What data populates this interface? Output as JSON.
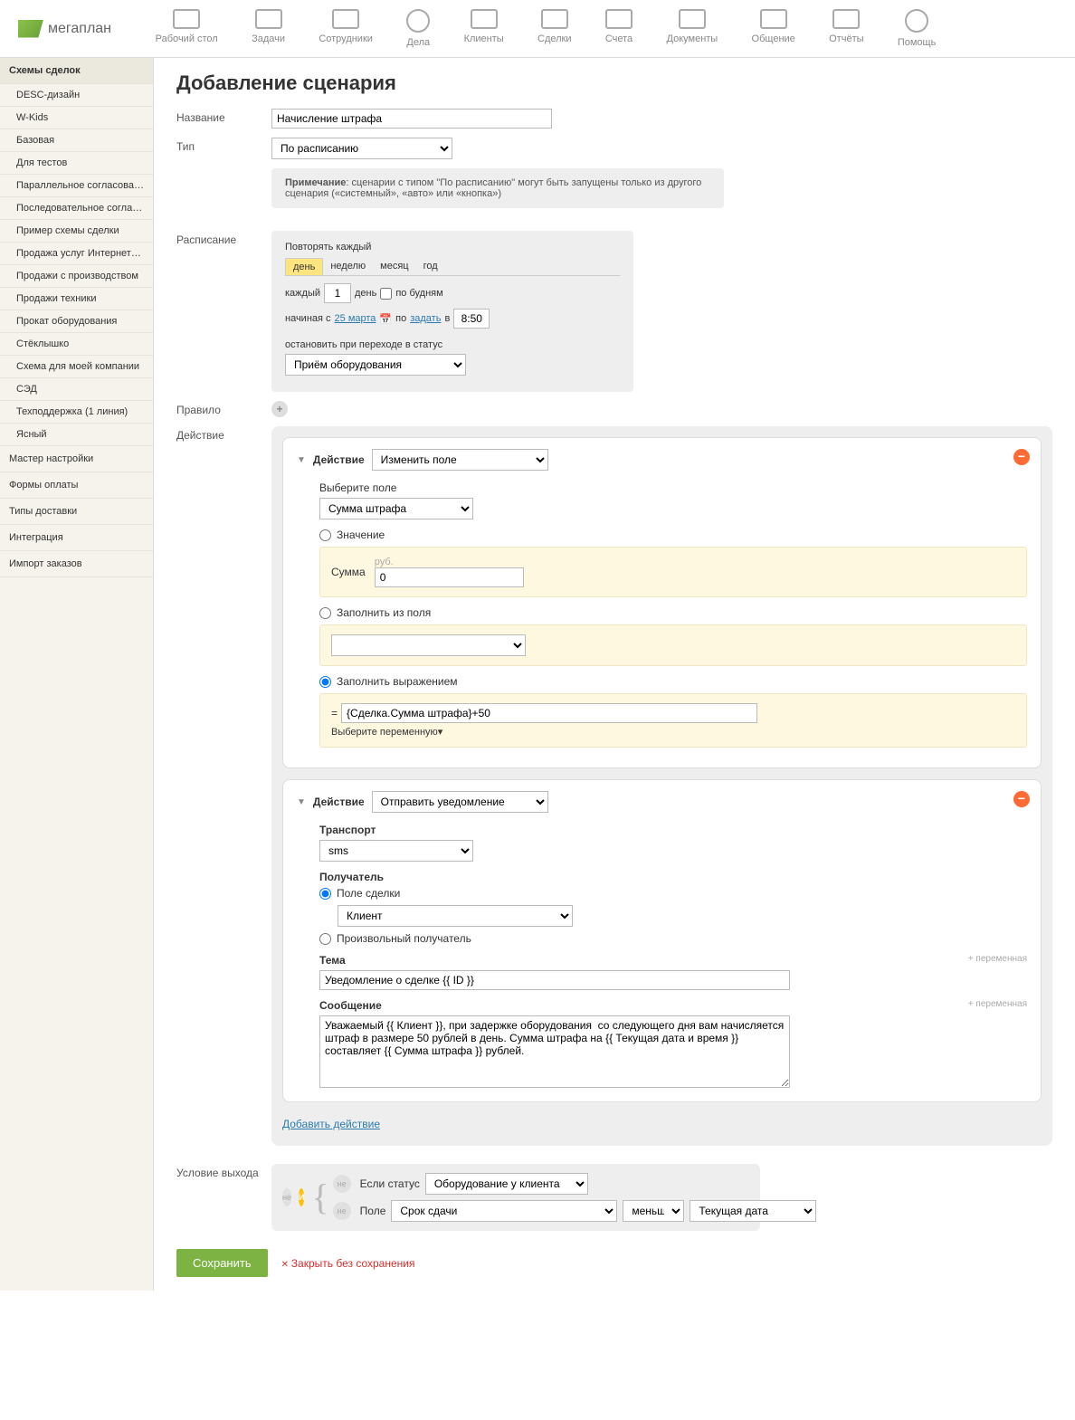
{
  "nav": {
    "logo": "мегаплан",
    "items": [
      "Рабочий стол",
      "Задачи",
      "Сотрудники",
      "Дела",
      "Клиенты",
      "Сделки",
      "Счета",
      "Документы",
      "Общение",
      "Отчёты",
      "Помощь"
    ]
  },
  "sidebar": {
    "header": "Схемы сделок",
    "items": [
      "DESC-дизайн",
      "W-Kids",
      "Базовая",
      "Для тестов",
      "Параллельное согласование",
      "Последовательное согласов...",
      "Пример схемы сделки",
      "Продажа услуг Интернет-аге...",
      "Продажи с производством",
      "Продажи техники",
      "Прокат оборудования",
      "Стёклышко",
      "Схема для моей компании",
      "СЭД",
      "Техподдержка (1 линия)",
      "Ясный"
    ],
    "plain": [
      "Мастер настройки",
      "Формы оплаты",
      "Типы доставки",
      "Интеграция",
      "Импорт заказов"
    ]
  },
  "page": {
    "title": "Добавление сценария",
    "name_label": "Название",
    "name_value": "Начисление штрафа",
    "type_label": "Тип",
    "type_value": "По расписанию",
    "note_label": "Примечание",
    "note_text": ": сценарии с типом \"По расписанию\" могут быть запущены только из другого сценария («системный», «авто» или «кнопка»)",
    "schedule_label": "Расписание",
    "schedule": {
      "repeat_title": "Повторять каждый",
      "tabs": [
        "день",
        "неделю",
        "месяц",
        "год"
      ],
      "every": "каждый",
      "every_val": "1",
      "days": "день",
      "weekdays": "по будням",
      "starting": "начиная с",
      "start_date": "25 марта",
      "to": "по",
      "set_link": "задать",
      "at": "в",
      "time": "8:50",
      "stop_label": "остановить при переходе в статус",
      "stop_value": "Приём оборудования"
    },
    "rule_label": "Правило",
    "action_label": "Действие",
    "action1": {
      "header": "Действие",
      "type": "Изменить поле",
      "select_field_label": "Выберите поле",
      "select_field": "Сумма штрафа",
      "opt_value": "Значение",
      "sum_label": "Сумма",
      "currency": "руб.",
      "sum_value": "0",
      "opt_fill": "Заполнить из поля",
      "opt_expr": "Заполнить выражением",
      "expr_value": "{Сделка.Сумма штрафа}+50",
      "var_link": "Выберите переменную▾"
    },
    "action2": {
      "header": "Действие",
      "type": "Отправить уведомление",
      "transport_label": "Транспорт",
      "transport": "sms",
      "recipient_label": "Получатель",
      "opt_deal_field": "Поле сделки",
      "recipient": "Клиент",
      "opt_custom": "Произвольный получатель",
      "subject_label": "Тема",
      "var_add": "+ переменная",
      "subject": "Уведомление о сделке {{ ID }}",
      "message_label": "Сообщение",
      "message": "Уважаемый {{ Клиент }}, при задержке оборудования  со следующего дня вам начисляется штраф в размере 50 рублей в день. Сумма штрафа на {{ Текущая дата и время }} составляет {{ Сумма штрафа }} рублей."
    },
    "add_action": "Добавить действие",
    "exit_label": "Условие выхода",
    "exit": {
      "and": "И",
      "not": "не",
      "if_status": "Если статус",
      "status_val": "Оборудование у клиента",
      "field_label": "Поле",
      "field_val": "Срок сдачи",
      "cmp": "меньше▾",
      "date_val": "Текущая дата"
    },
    "save": "Сохранить",
    "cancel": "Закрыть без сохранения"
  }
}
